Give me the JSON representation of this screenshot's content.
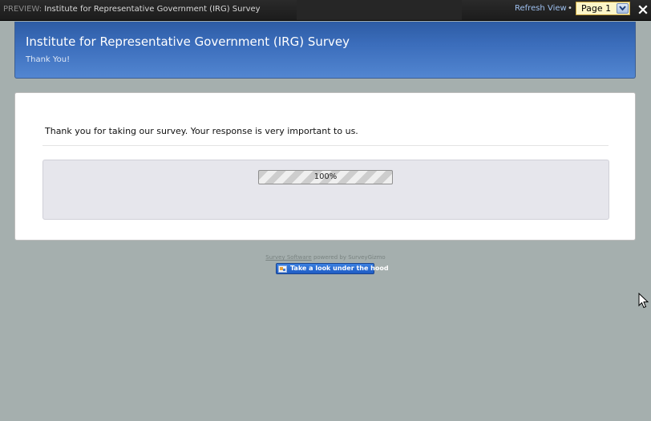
{
  "topbar": {
    "preview_label": "PREVIEW:",
    "survey_title": "Institute for Representative Government (IRG) Survey",
    "refresh_label": "Refresh View",
    "separator": "•",
    "page_select_value": "Page 1"
  },
  "header": {
    "title": "Institute for Representative Government (IRG) Survey",
    "subtitle": "Thank You!"
  },
  "main": {
    "thank_you_message": "Thank you for taking our survey. Your response is very important to us.",
    "progress": {
      "percent": 100,
      "label": "100%"
    }
  },
  "footer": {
    "software_link": "Survey Software",
    "powered_by": "powered by SurveyGizmo",
    "hood_button_label": "Take a look under the hood"
  },
  "colors": {
    "header_blue": "#3b6dbb",
    "page_background": "#a5afae",
    "topbar_background": "#1c1c1c",
    "page_select_background": "#fdf6c8",
    "hood_button_blue": "#1f5cc4"
  },
  "icons": {
    "close": "close-icon",
    "dropdown": "chevron-down-icon",
    "hood": "hood-icon",
    "cursor": "mouse-pointer-icon"
  }
}
